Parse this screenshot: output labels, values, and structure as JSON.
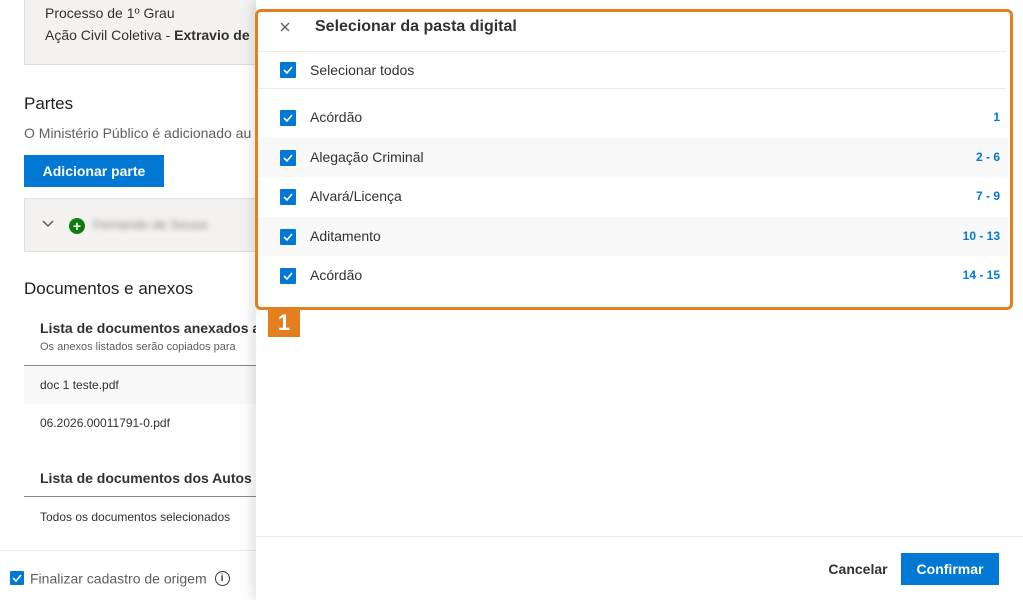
{
  "background": {
    "process_degree": "Processo de 1º Grau",
    "action_type": "Ação Civil Coletiva - ",
    "action_subject": "Extravio de",
    "parties_heading": "Partes",
    "parties_note": "O Ministério Público é adicionado au",
    "add_party_label": "Adicionar parte",
    "party_name": "Fernando de Sousa",
    "documents_heading": "Documentos e anexos",
    "attached_list_title": "Lista de documentos anexados ao",
    "attached_list_note": "Os anexos listados serão copiados para",
    "attached_files": [
      "doc 1 teste.pdf",
      "06.2026.00011791-0.pdf"
    ],
    "autos_list_title": "Lista de documentos dos Autos in",
    "autos_selected_text": "Todos os documentos selecionados",
    "finalize_label": "Finalizar cadastro de origem",
    "finalize_checked": true
  },
  "panel": {
    "title": "Selecionar da pasta digital",
    "select_all_label": "Selecionar todos",
    "select_all_checked": true,
    "items": [
      {
        "name": "Acórdão",
        "pages": "1",
        "checked": true
      },
      {
        "name": "Alegação Criminal",
        "pages": "2 - 6",
        "checked": true
      },
      {
        "name": "Alvará/Licença",
        "pages": "7 - 9",
        "checked": true
      },
      {
        "name": "Aditamento",
        "pages": "10 - 13",
        "checked": true
      },
      {
        "name": "Acórdão",
        "pages": "14 - 15",
        "checked": true
      }
    ],
    "cancel_label": "Cancelar",
    "confirm_label": "Confirmar"
  },
  "annotation": {
    "step_number": "1",
    "color": "#e37f1f"
  },
  "colors": {
    "accent": "#0078d4",
    "success": "#107c10"
  },
  "icons": [
    "close-icon",
    "checkbox-checked-icon",
    "chevron-down-icon",
    "add-circle-icon",
    "info-icon"
  ]
}
